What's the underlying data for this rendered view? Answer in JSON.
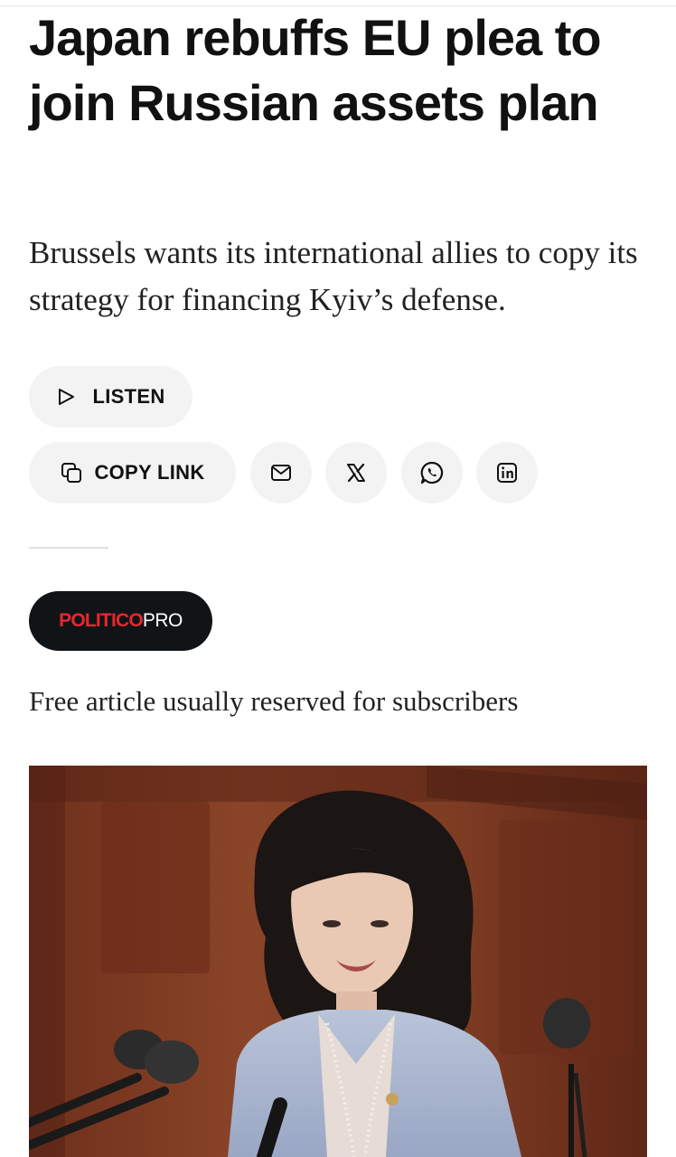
{
  "article": {
    "headline": "Japan rebuffs EU plea to join Russian assets plan",
    "subheadline": "Brussels wants its international allies to copy its strategy for financing Kyiv’s defense.",
    "access_note": "Free article usually reserved for subscribers"
  },
  "actions": {
    "listen_label": "LISTEN",
    "copy_link_label": "COPY LINK",
    "share_icons": [
      "email-icon",
      "x-logo-icon",
      "whatsapp-icon",
      "linkedin-icon"
    ]
  },
  "badge": {
    "brand": "POLITICO",
    "product": "PRO",
    "brand_color": "#e8272c"
  },
  "colors": {
    "pill_background": "#f3f3f3",
    "badge_background": "#111417"
  }
}
